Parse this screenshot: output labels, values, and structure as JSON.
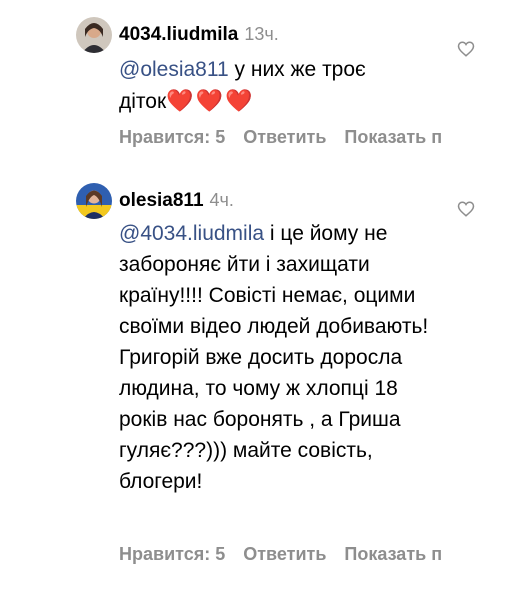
{
  "comments": [
    {
      "username": "4034.liudmila",
      "time": "13ч.",
      "mention": "@olesia811",
      "text_1": " у них же троє",
      "text_2": "діток",
      "hearts": "❤️❤️❤️",
      "likes": "Нравится: 5",
      "reply": "Ответить",
      "show": "Показать п"
    },
    {
      "username": "olesia811",
      "time": "4ч.",
      "mention": "@4034.liudmila",
      "text_1": " і це йому не забороняє йти і захищати країну!!!! Совісті немає, оцими своїми відео людей добивають! Григорій вже досить доросла людина, то чому ж хлопці 18 років нас боронять , а Гриша гуляє???))) майте совість, блогери!",
      "likes": "Нравится: 5",
      "reply": "Ответить",
      "show": "Показать п"
    }
  ],
  "icons": {
    "like": "heart-outline-icon"
  },
  "colors": {
    "mention": "#385185",
    "meta": "#8e8e8e",
    "heart": "#e0122a"
  }
}
